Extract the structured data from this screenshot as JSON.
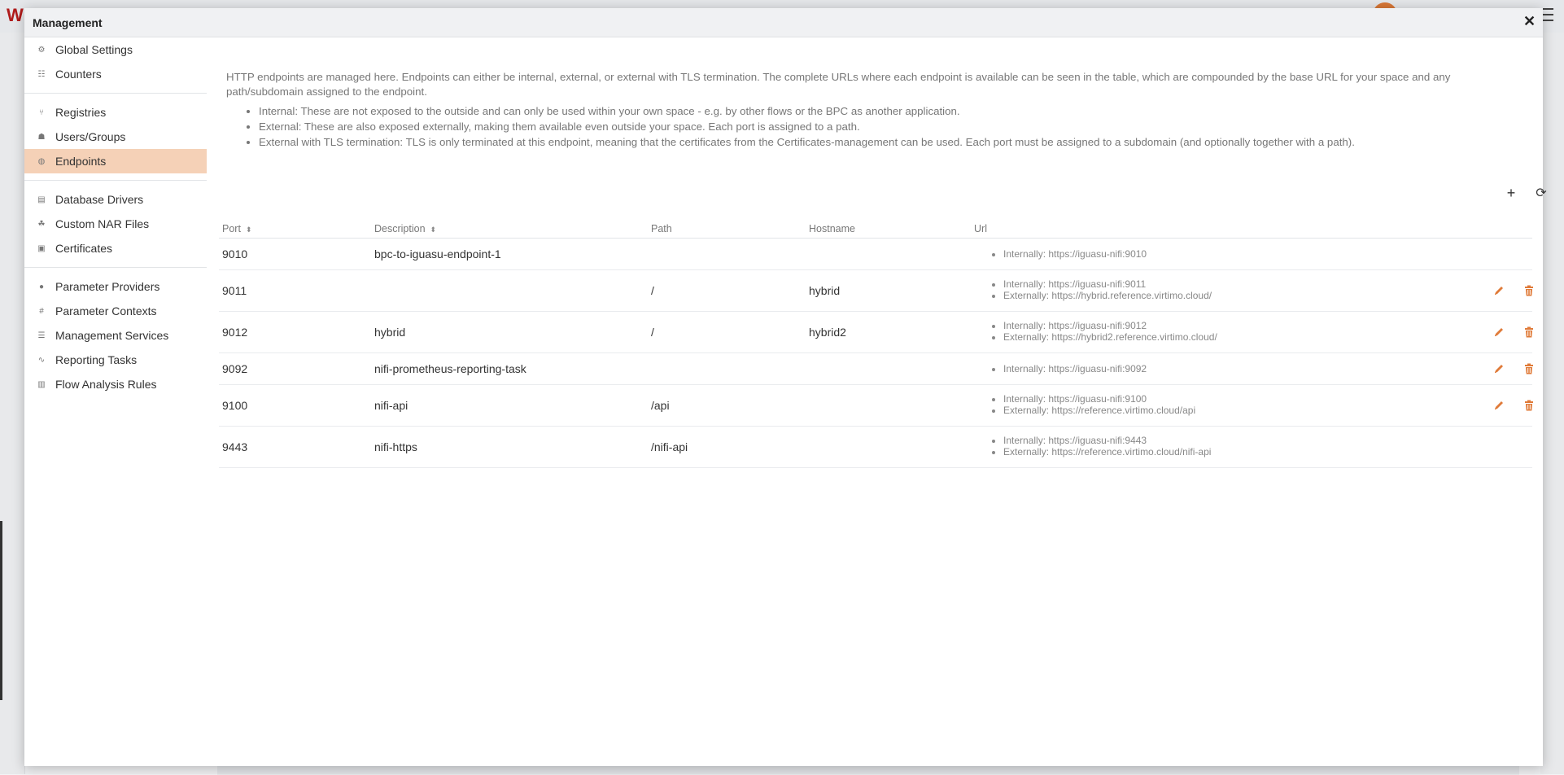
{
  "dialog": {
    "title": "Management",
    "close_label": "✕"
  },
  "sidebar": {
    "groups": [
      [
        {
          "label": "Global Settings",
          "icon": "gear-icon"
        },
        {
          "label": "Counters",
          "icon": "counters-icon"
        }
      ],
      [
        {
          "label": "Registries",
          "icon": "registries-icon"
        },
        {
          "label": "Users/Groups",
          "icon": "users-icon"
        },
        {
          "label": "Endpoints",
          "icon": "globe-icon",
          "active": true
        }
      ],
      [
        {
          "label": "Database Drivers",
          "icon": "database-icon"
        },
        {
          "label": "Custom NAR Files",
          "icon": "nar-files-icon"
        },
        {
          "label": "Certificates",
          "icon": "lock-icon"
        }
      ],
      [
        {
          "label": "Parameter Providers",
          "icon": "provider-icon"
        },
        {
          "label": "Parameter Contexts",
          "icon": "hash-icon"
        },
        {
          "label": "Management Services",
          "icon": "services-icon"
        },
        {
          "label": "Reporting Tasks",
          "icon": "chart-icon"
        },
        {
          "label": "Flow Analysis Rules",
          "icon": "trash-icon"
        }
      ]
    ]
  },
  "intro": {
    "paragraph": "HTTP endpoints are managed here. Endpoints can either be internal, external, or external with TLS termination. The complete URLs where each endpoint is available can be seen in the table, which are compounded by the base URL for your space and any path/subdomain assigned to the endpoint.",
    "bullets": [
      "Internal: These are not exposed to the outside and can only be used within your own space - e.g. by other flows or the BPC as another application.",
      "External: These are also exposed externally, making them available even outside your space. Each port is assigned to a path.",
      "External with TLS termination: TLS is only terminated at this endpoint, meaning that the certificates from the Certificates-management can be used. Each port must be assigned to a subdomain (and optionally together with a path)."
    ]
  },
  "toolbar": {
    "add_icon": "+",
    "refresh_icon": "⟳"
  },
  "table": {
    "headers": {
      "port": "Port",
      "description": "Description",
      "path": "Path",
      "hostname": "Hostname",
      "url": "Url"
    },
    "sort_icon": "⬍",
    "rows": [
      {
        "port": "9010",
        "description": "bpc-to-iguasu-endpoint-1",
        "path": "",
        "hostname": "",
        "urls": [
          "Internally: https://iguasu-nifi:9010"
        ],
        "actions": false
      },
      {
        "port": "9011",
        "description": "",
        "path": "/",
        "hostname": "hybrid",
        "urls": [
          "Internally: https://iguasu-nifi:9011",
          "Externally: https://hybrid.reference.virtimo.cloud/"
        ],
        "actions": true
      },
      {
        "port": "9012",
        "description": "hybrid",
        "path": "/",
        "hostname": "hybrid2",
        "urls": [
          "Internally: https://iguasu-nifi:9012",
          "Externally: https://hybrid2.reference.virtimo.cloud/"
        ],
        "actions": true
      },
      {
        "port": "9092",
        "description": "nifi-prometheus-reporting-task",
        "path": "",
        "hostname": "",
        "urls": [
          "Internally: https://iguasu-nifi:9092"
        ],
        "actions": true
      },
      {
        "port": "9100",
        "description": "nifi-api",
        "path": "/api",
        "hostname": "",
        "urls": [
          "Internally: https://iguasu-nifi:9100",
          "Externally: https://reference.virtimo.cloud/api"
        ],
        "actions": true
      },
      {
        "port": "9443",
        "description": "nifi-https",
        "path": "/nifi-api",
        "hostname": "",
        "urls": [
          "Internally: https://iguasu-nifi:9443",
          "Externally: https://reference.virtimo.cloud/nifi-api"
        ],
        "actions": false
      }
    ]
  },
  "colors": {
    "accent": "#e07b39",
    "active_bg": "#f5d1b7",
    "muted_text": "#777777"
  }
}
